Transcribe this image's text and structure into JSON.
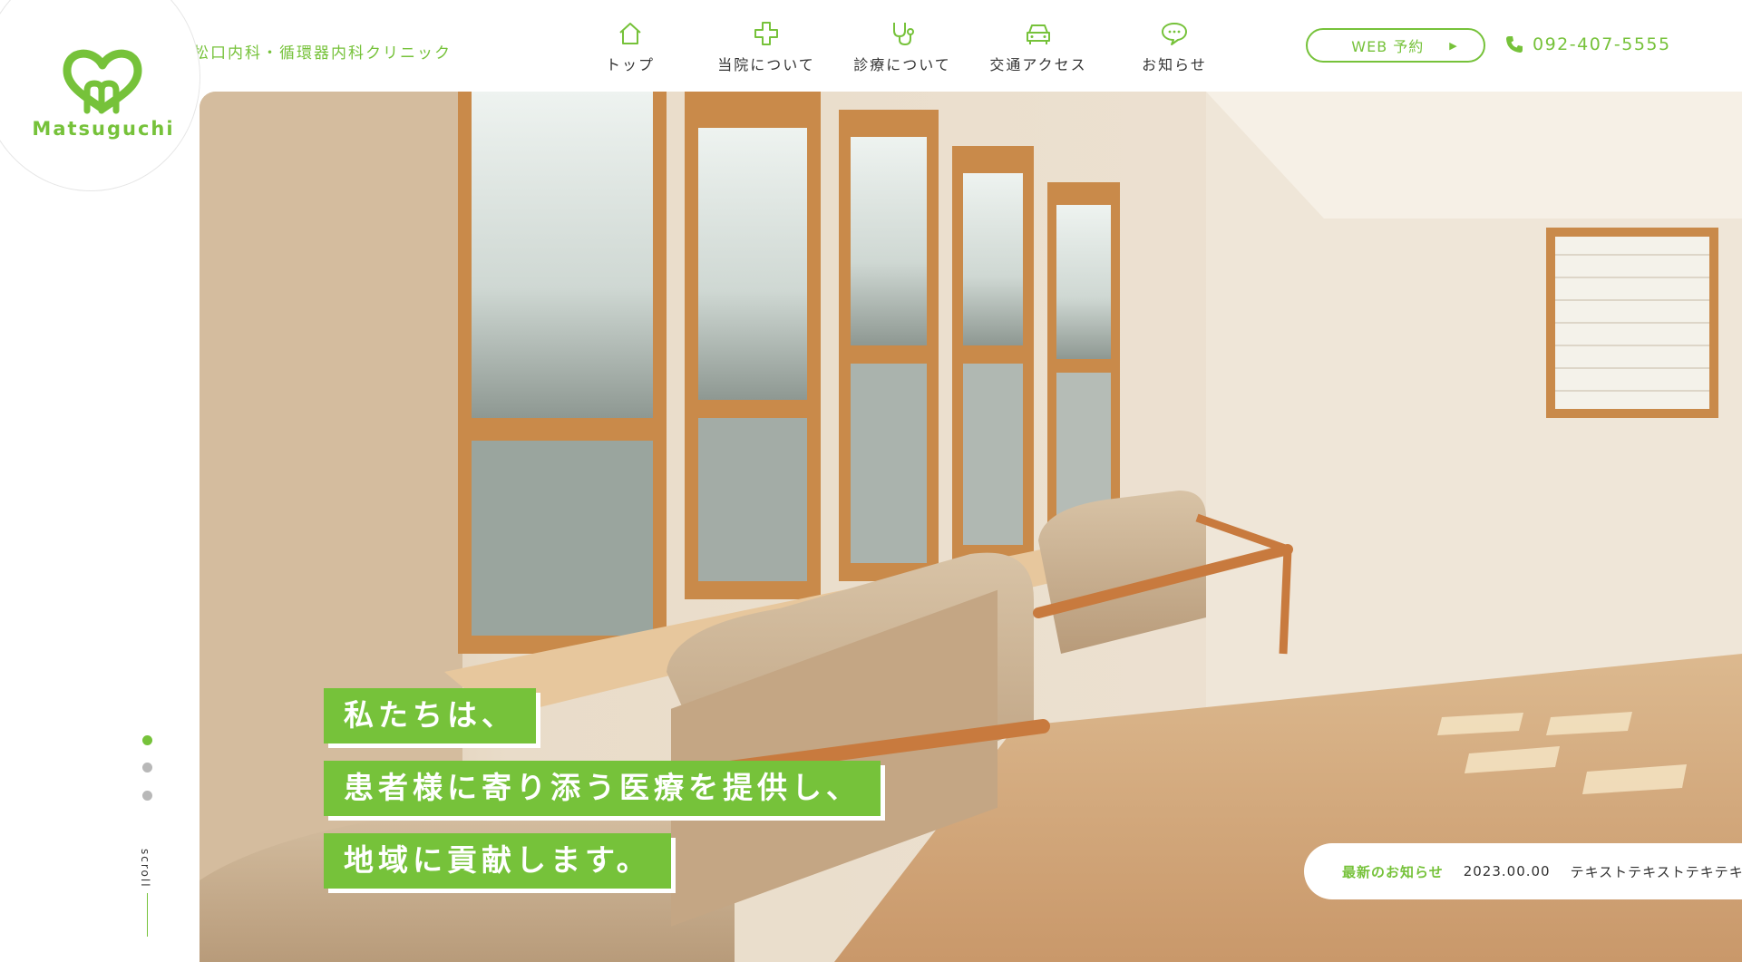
{
  "brand": {
    "logo_text": "Matsuguchi",
    "clinic_name": "松口内科・循環器内科クリニック",
    "accent": "#76c23a"
  },
  "nav": [
    {
      "label": "トップ",
      "icon": "home-icon"
    },
    {
      "label": "当院について",
      "icon": "cross-icon"
    },
    {
      "label": "診療について",
      "icon": "stethoscope-icon"
    },
    {
      "label": "交通アクセス",
      "icon": "car-icon"
    },
    {
      "label": "お知らせ",
      "icon": "speech-bubble-icon"
    }
  ],
  "header": {
    "web_button": "WEB 予約",
    "phone": "092-407-5555"
  },
  "hero": {
    "tagline": [
      "私たちは、",
      "患者様に寄り添う医療を提供し、",
      "地域に貢献します。"
    ]
  },
  "news": {
    "title": "最新のお知らせ",
    "date": "2023.00.00",
    "text": "テキストテキストテキテキスト…"
  },
  "slider": {
    "dot_count": 3,
    "active_index": 0,
    "scroll_label": "scroll"
  }
}
